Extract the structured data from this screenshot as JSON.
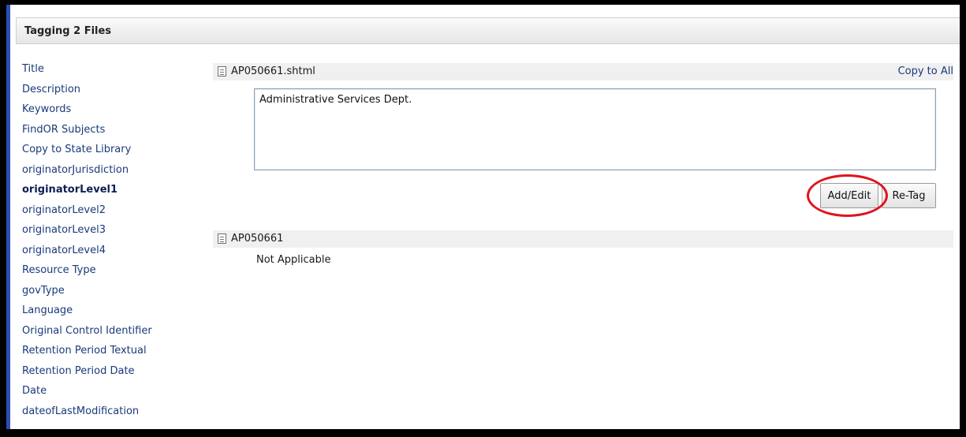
{
  "header": {
    "title": "Tagging 2 Files"
  },
  "sidebar": {
    "items": [
      {
        "label": "Title"
      },
      {
        "label": "Description"
      },
      {
        "label": "Keywords"
      },
      {
        "label": "FindOR Subjects"
      },
      {
        "label": "Copy to State Library"
      },
      {
        "label": "originatorJurisdiction"
      },
      {
        "label": "originatorLevel1",
        "active": true
      },
      {
        "label": "originatorLevel2"
      },
      {
        "label": "originatorLevel3"
      },
      {
        "label": "originatorLevel4"
      },
      {
        "label": "Resource Type"
      },
      {
        "label": "govType"
      },
      {
        "label": "Language"
      },
      {
        "label": "Original Control Identifier"
      },
      {
        "label": "Retention Period Textual"
      },
      {
        "label": "Retention Period Date"
      },
      {
        "label": "Date"
      },
      {
        "label": "dateofLastModification"
      }
    ]
  },
  "files": [
    {
      "name": "AP050661.shtml",
      "copy_to_all_label": "Copy to All",
      "value": "Administrative Services Dept.",
      "add_edit_label": "Add/Edit",
      "retag_label": "Re-Tag"
    },
    {
      "name": "AP050661",
      "value": "Not Applicable"
    }
  ],
  "colors": {
    "highlight": "#e0141e",
    "link": "#1a3a7a",
    "accent_strip": "#2a4fb0"
  }
}
